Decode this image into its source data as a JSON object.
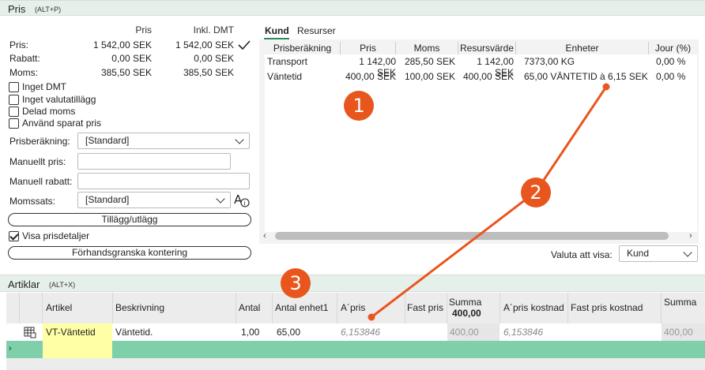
{
  "pris_section": {
    "title": "Pris",
    "shortcut": "(ALT+P)",
    "col_pris": "Pris",
    "col_inkl": "Inkl. DMT",
    "rows": [
      {
        "label": "Pris:",
        "pris": "1 542,00 SEK",
        "inkl": "1 542,00 SEK"
      },
      {
        "label": "Rabatt:",
        "pris": "0,00 SEK",
        "inkl": "0,00 SEK"
      },
      {
        "label": "Moms:",
        "pris": "385,50 SEK",
        "inkl": "385,50 SEK"
      }
    ],
    "checkboxes": [
      {
        "label": "Inget DMT",
        "checked": false
      },
      {
        "label": "Inget valutatillägg",
        "checked": false
      },
      {
        "label": "Delad moms",
        "checked": false
      },
      {
        "label": "Använd sparat pris",
        "checked": false
      }
    ],
    "prisberakning_label": "Prisberäkning:",
    "prisberakning_value": "[Standard]",
    "manuellt_pris_label": "Manuellt pris:",
    "manuell_rabatt_label": "Manuell rabatt:",
    "momssats_label": "Momssats:",
    "momssats_value": "[Standard]",
    "tillagg_button": "Tillägg/utlägg",
    "visa_prisdetaljer": "Visa prisdetaljer",
    "forhandsgranska_button": "Förhandsgranska kontering",
    "tabs": [
      "Kund",
      "Resurser"
    ],
    "grid": {
      "headers": [
        "Prisberäkning",
        "Pris",
        "Moms",
        "Resursvärde",
        "Enheter",
        "Jour (%)"
      ],
      "rows": [
        [
          "Transport",
          "1 142,00 SEK",
          "285,50 SEK",
          "1 142,00 SEK",
          "7373,00 KG",
          "0,00 %"
        ],
        [
          "Väntetid",
          "400,00 SEK",
          "100,00 SEK",
          "400,00 SEK",
          "65,00 VÄNTETID à 6,15 SEK",
          "0,00 %"
        ]
      ]
    },
    "valuta_label": "Valuta att visa:",
    "valuta_value": "Kund"
  },
  "artiklar_section": {
    "title": "Artiklar",
    "shortcut": "(ALT+X)",
    "headers": {
      "artikel": "Artikel",
      "beskrivning": "Beskrivning",
      "antal": "Antal",
      "antal_enhet1": "Antal enhet1",
      "a_pris": "A´pris",
      "fast_pris": "Fast pris",
      "summa": "Summa",
      "summa_total": "400,00",
      "a_pris_kostnad": "A´pris kostnad",
      "fast_pris_kostnad": "Fast pris kostnad",
      "summa2": "Summa"
    },
    "row": {
      "artikel": "VT-Väntetid",
      "beskrivning": "Väntetid.",
      "antal": "1,00",
      "antal_enhet1": "65,00",
      "a_pris": "6,153846",
      "summa": "400,00",
      "a_pris_kostnad": "6,153846",
      "summa2": "400,00"
    }
  },
  "badges": [
    "1",
    "2",
    "3"
  ],
  "colors": {
    "accent": "#e8561e",
    "header_bg": "#e6f0ea",
    "selected_row": "#7ecfaa",
    "highlight": "#ffffa6"
  }
}
